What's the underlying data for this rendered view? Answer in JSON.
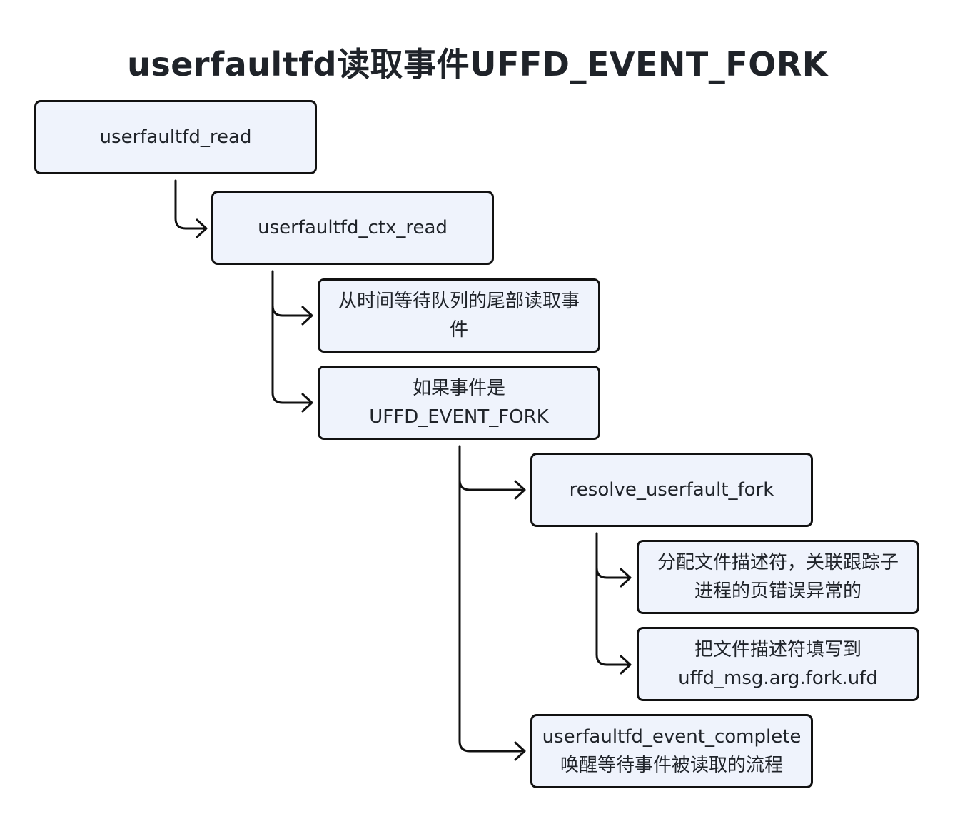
{
  "title": "userfaultfd读取事件UFFD_EVENT_FORK",
  "colors": {
    "node_fill": "#eff3fc",
    "node_border": "#111111",
    "connector": "#111111",
    "text": "#1f2329"
  },
  "nodes": {
    "userfaultfd_read": {
      "lines": [
        "userfaultfd_read"
      ]
    },
    "userfaultfd_ctx_read": {
      "lines": [
        "userfaultfd_ctx_read"
      ]
    },
    "read_event": {
      "lines": [
        "从时间等待队列的尾部读取事",
        "件"
      ]
    },
    "if_fork": {
      "lines": [
        "如果事件是",
        "UFFD_EVENT_FORK"
      ]
    },
    "resolve_userfault_fork": {
      "lines": [
        "resolve_userfault_fork"
      ]
    },
    "alloc_fd": {
      "lines": [
        "分配文件描述符，关联跟踪子",
        "进程的页错误异常的"
      ]
    },
    "fill_fd": {
      "lines": [
        "把文件描述符填写到",
        "uffd_msg.arg.fork.ufd"
      ]
    },
    "event_complete": {
      "lines": [
        "userfaultfd_event_complete",
        "唤醒等待事件被读取的流程"
      ]
    }
  }
}
